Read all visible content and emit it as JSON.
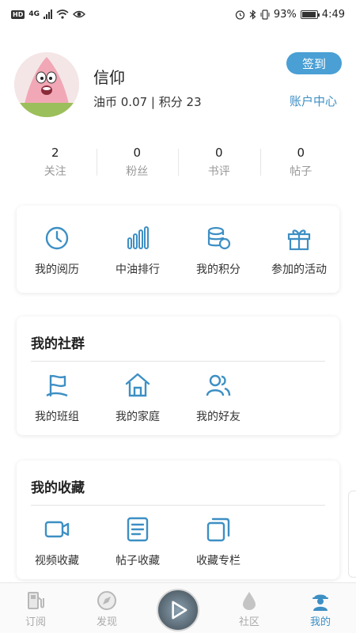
{
  "status_bar": {
    "left_badge": "HD",
    "network": "4G",
    "battery_text": "93%",
    "battery_level": 0.93,
    "time": "4:49"
  },
  "profile": {
    "username": "信仰",
    "coins_line": "油币 0.07 | 积分 23",
    "checkin_label": "签到",
    "account_center_label": "账户中心"
  },
  "stats": [
    {
      "value": "2",
      "label": "关注"
    },
    {
      "value": "0",
      "label": "粉丝"
    },
    {
      "value": "0",
      "label": "书评"
    },
    {
      "value": "0",
      "label": "帖子"
    }
  ],
  "quick_actions": [
    {
      "label": "我的阅历",
      "icon": "clock-icon"
    },
    {
      "label": "中油排行",
      "icon": "bar-chart-icon"
    },
    {
      "label": "我的积分",
      "icon": "coins-icon"
    },
    {
      "label": "参加的活动",
      "icon": "gift-icon"
    }
  ],
  "community": {
    "title": "我的社群",
    "items": [
      {
        "label": "我的班组",
        "icon": "flag-icon"
      },
      {
        "label": "我的家庭",
        "icon": "home-icon"
      },
      {
        "label": "我的好友",
        "icon": "friends-icon"
      }
    ]
  },
  "favorites": {
    "title": "我的收藏",
    "items": [
      {
        "label": "视频收藏",
        "icon": "video-icon"
      },
      {
        "label": "帖子收藏",
        "icon": "document-icon"
      },
      {
        "label": "收藏专栏",
        "icon": "stack-icon"
      }
    ]
  },
  "bottom_nav": [
    {
      "label": "订阅",
      "icon": "fuel-pump-icon"
    },
    {
      "label": "发现",
      "icon": "compass-icon"
    },
    {
      "label": "",
      "icon": "play-disc-icon"
    },
    {
      "label": "社区",
      "icon": "drop-icon"
    },
    {
      "label": "我的",
      "icon": "worker-icon",
      "active": true
    }
  ],
  "colors": {
    "accent": "#4a9fd4",
    "link": "#3d8fc4",
    "icon": "#3d8fc4"
  }
}
